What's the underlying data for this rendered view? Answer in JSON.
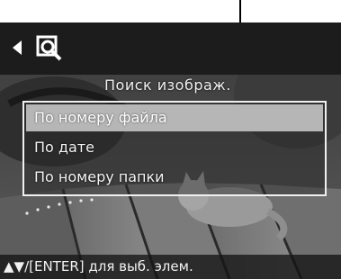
{
  "header": {
    "back_icon": "left-triangle-icon",
    "mode_icon": "image-search-magnifier-icon"
  },
  "menu": {
    "title": "Поиск изображ.",
    "items": [
      {
        "label": "По номеру файла",
        "selected": true
      },
      {
        "label": "По дате",
        "selected": false
      },
      {
        "label": "По номеру папки",
        "selected": false
      }
    ]
  },
  "help": {
    "text": "▲▼/[ENTER] для выб. элем."
  },
  "colors": {
    "selection_highlight": "#b6b6b6",
    "menu_border": "#f0f0f0",
    "text": "#f4f4f4",
    "topbar": "#1c1c1c"
  }
}
